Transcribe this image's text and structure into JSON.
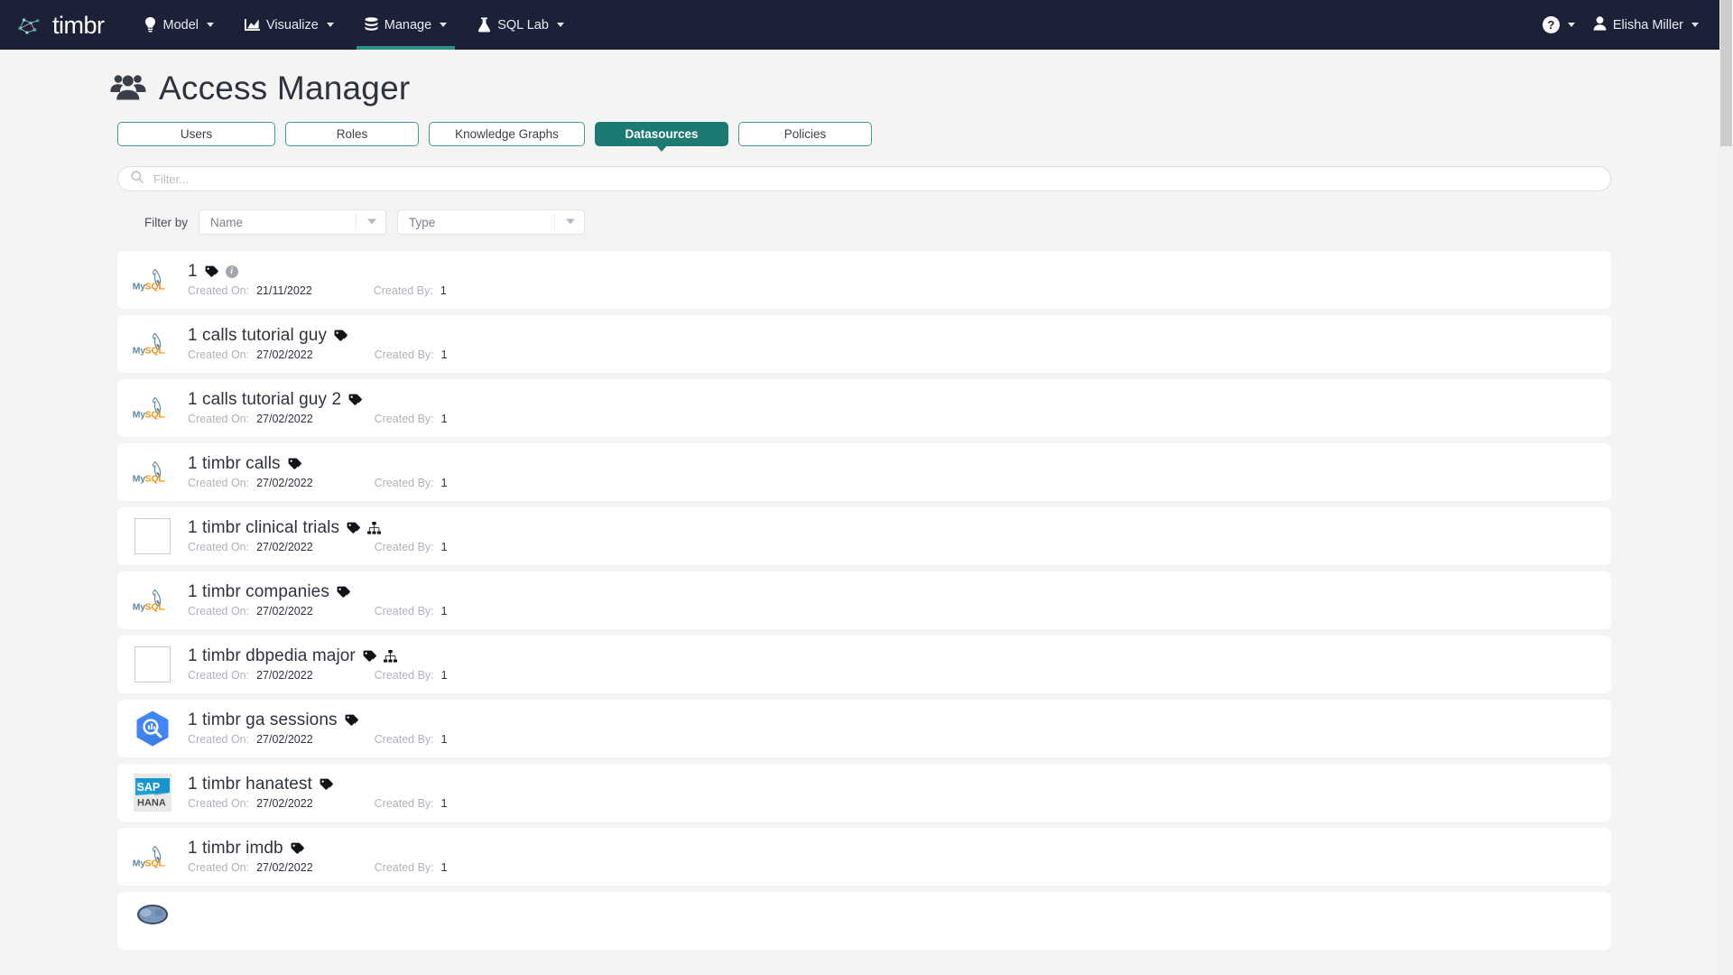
{
  "navbar": {
    "brand": "timbr",
    "items": [
      {
        "label": "Model",
        "icon": "lightbulb-icon",
        "active": false
      },
      {
        "label": "Visualize",
        "icon": "chart-icon",
        "active": false
      },
      {
        "label": "Manage",
        "icon": "database-icon",
        "active": true
      },
      {
        "label": "SQL Lab",
        "icon": "flask-icon",
        "active": false
      }
    ],
    "help_label": "?",
    "user_name": "Elisha Miller"
  },
  "header": {
    "title": "Access Manager",
    "icon": "users-group-icon"
  },
  "tabs": [
    {
      "label": "Users",
      "active": false
    },
    {
      "label": "Roles",
      "active": false
    },
    {
      "label": "Knowledge Graphs",
      "active": false
    },
    {
      "label": "Datasources",
      "active": true
    },
    {
      "label": "Policies",
      "active": false
    }
  ],
  "search": {
    "placeholder": "Filter...",
    "value": "",
    "icon": "search-icon"
  },
  "filter": {
    "label": "Filter by",
    "name_select": {
      "value": "Name",
      "icon": "chevron-down-icon"
    },
    "type_select": {
      "value": "Type",
      "icon": "chevron-down-icon"
    }
  },
  "list": {
    "created_on_label": "Created On:",
    "created_by_label": "Created By:",
    "rows": [
      {
        "name": "1",
        "logo": "mysql",
        "created_on": "21/11/2022",
        "created_by": "1",
        "has_tag": true,
        "has_info": true,
        "has_graph": false
      },
      {
        "name": "1 calls tutorial guy",
        "logo": "mysql",
        "created_on": "27/02/2022",
        "created_by": "1",
        "has_tag": true,
        "has_info": false,
        "has_graph": false
      },
      {
        "name": "1 calls tutorial guy 2",
        "logo": "mysql",
        "created_on": "27/02/2022",
        "created_by": "1",
        "has_tag": true,
        "has_info": false,
        "has_graph": false
      },
      {
        "name": "1 timbr calls",
        "logo": "mysql",
        "created_on": "27/02/2022",
        "created_by": "1",
        "has_tag": true,
        "has_info": false,
        "has_graph": false
      },
      {
        "name": "1 timbr clinical trials",
        "logo": "blank",
        "created_on": "27/02/2022",
        "created_by": "1",
        "has_tag": true,
        "has_info": false,
        "has_graph": true
      },
      {
        "name": "1 timbr companies",
        "logo": "mysql",
        "created_on": "27/02/2022",
        "created_by": "1",
        "has_tag": true,
        "has_info": false,
        "has_graph": false
      },
      {
        "name": "1 timbr dbpedia major",
        "logo": "blank",
        "created_on": "27/02/2022",
        "created_by": "1",
        "has_tag": true,
        "has_info": false,
        "has_graph": true
      },
      {
        "name": "1 timbr ga sessions",
        "logo": "bigquery",
        "created_on": "27/02/2022",
        "created_by": "1",
        "has_tag": true,
        "has_info": false,
        "has_graph": false
      },
      {
        "name": "1 timbr hanatest",
        "logo": "saphana",
        "created_on": "27/02/2022",
        "created_by": "1",
        "has_tag": true,
        "has_info": false,
        "has_graph": false
      },
      {
        "name": "1 timbr imdb",
        "logo": "mysql",
        "created_on": "27/02/2022",
        "created_by": "1",
        "has_tag": true,
        "has_info": false,
        "has_graph": false
      },
      {
        "name": "",
        "logo": "mongodb",
        "created_on": "",
        "created_by": "",
        "has_tag": false,
        "has_info": false,
        "has_graph": false
      }
    ]
  },
  "colors": {
    "navbar_bg": "#1c2138",
    "accent_teal": "#1d7a73",
    "tab_border": "#3f9c94",
    "page_bg": "#f4f4f5",
    "row_bg": "#ffffff",
    "title_text": "#2f3340",
    "muted_text": "#aeb2ba"
  }
}
